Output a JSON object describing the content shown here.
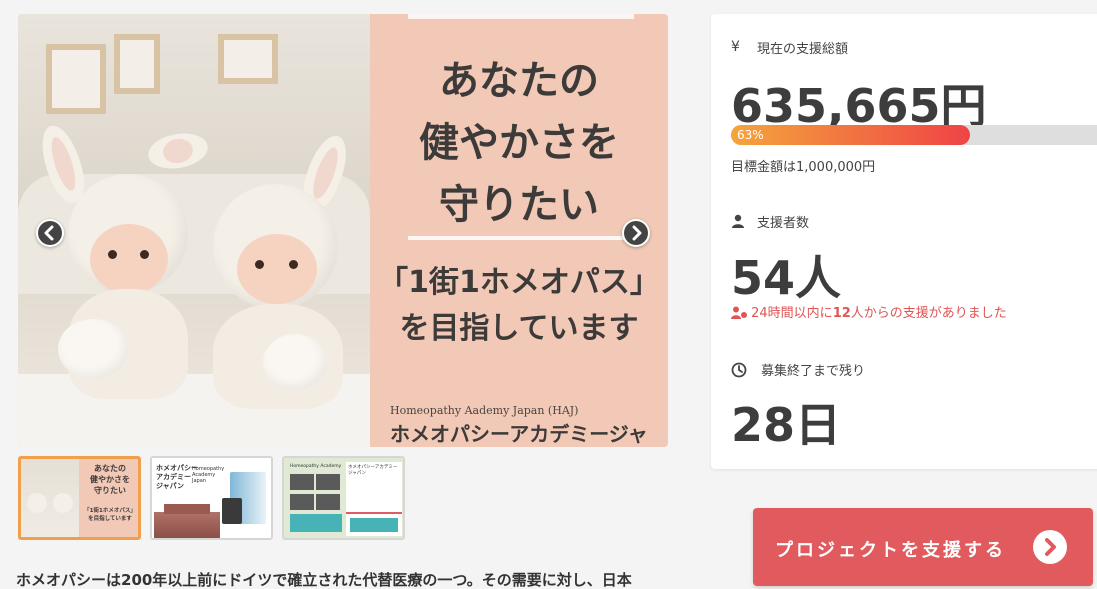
{
  "hero": {
    "headline_lines": [
      "あなたの",
      "健やかさを",
      "守りたい"
    ],
    "sub_lines": [
      "「1街1ホメオパス」",
      "を目指しています"
    ],
    "brand_en": "Homeopathy Aademy Japan (HAJ)",
    "brand_ja": "ホメオパシーアカデミージャパン"
  },
  "thumbnails": {
    "t1": {
      "text_lines": [
        "あなたの",
        "健やかさを",
        "守りたい"
      ],
      "sub_lines": [
        "「1街1ホメオパス」",
        "を目指しています"
      ]
    },
    "t2": {
      "title_lines": [
        "ホメオパシー",
        "アカデミー",
        "ジャパン"
      ],
      "sub_lines": [
        "Homeopathy",
        "Academy",
        "Japan"
      ]
    },
    "t3": {
      "left_label": "Homeopathy Academy",
      "right_label": "ホメオパシーアカデミージャパン"
    }
  },
  "description": "ホメオパシーは200年以上前にドイツで確立された代替医療の一つ。その需要に対し、日本",
  "stats": {
    "total_label": "現在の支援総額",
    "total_icon": "yen-icon",
    "total_value": "635,665円",
    "progress_percent": 63,
    "progress_text": "63%",
    "target_text": "目標金額は1,000,000円",
    "supporters_label": "支援者数",
    "supporters_icon": "person-icon",
    "supporters_value": "54人",
    "recent_prefix": "24時間以内に",
    "recent_count": "12",
    "recent_suffix": "人からの支援がありました",
    "remaining_label": "募集終了まで残り",
    "remaining_icon": "clock-icon",
    "remaining_value": "28日"
  },
  "cta": {
    "label": "プロジェクトを支援する"
  },
  "colors": {
    "accent": "#e15a5e",
    "progress_start": "#f4a53c",
    "progress_end": "#ef4346",
    "hero_bg": "#f1c9b6",
    "alert_text": "#e05454"
  }
}
